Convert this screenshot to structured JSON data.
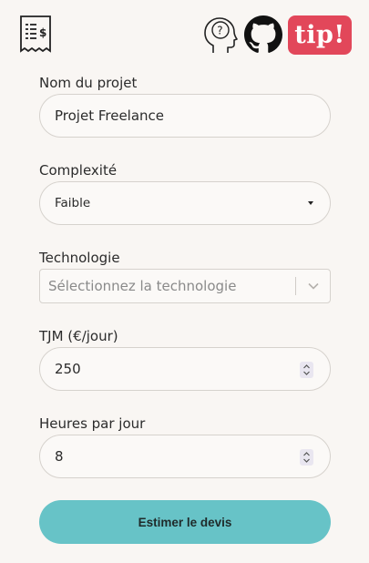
{
  "header": {
    "logo_icon": "receipt-dollar-icon",
    "help_icon": "head-question-icon",
    "github_icon": "github-icon",
    "tip_label": "tip!",
    "tip_color": "#e2475a"
  },
  "form": {
    "project_name": {
      "label": "Nom du projet",
      "value": "Projet Freelance"
    },
    "complexity": {
      "label": "Complexité",
      "selected": "Faible"
    },
    "technology": {
      "label": "Technologie",
      "placeholder": "Sélectionnez la technologie"
    },
    "daily_rate": {
      "label": "TJM (€/jour)",
      "value": "250"
    },
    "hours_per_day": {
      "label": "Heures par jour",
      "value": "8"
    },
    "submit_label": "Estimer le devis",
    "submit_color": "#67c3c7"
  }
}
